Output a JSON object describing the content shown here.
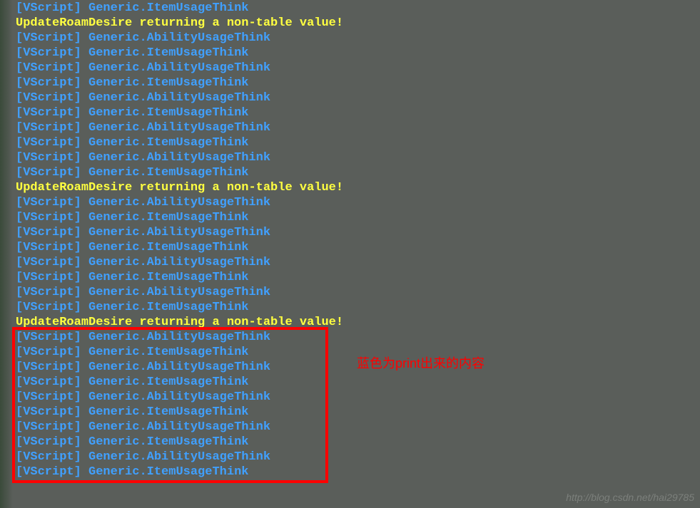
{
  "console": {
    "prefix": "[VScript]",
    "ability_msg": "Generic.AbilityUsageThink",
    "item_msg": "Generic.ItemUsageThink",
    "warning_msg": "UpdateRoamDesire returning a non-table value!",
    "lines": [
      {
        "type": "item"
      },
      {
        "type": "warning"
      },
      {
        "type": "ability"
      },
      {
        "type": "item"
      },
      {
        "type": "ability"
      },
      {
        "type": "item"
      },
      {
        "type": "ability"
      },
      {
        "type": "item"
      },
      {
        "type": "ability"
      },
      {
        "type": "item"
      },
      {
        "type": "ability"
      },
      {
        "type": "item"
      },
      {
        "type": "warning"
      },
      {
        "type": "ability"
      },
      {
        "type": "item"
      },
      {
        "type": "ability"
      },
      {
        "type": "item"
      },
      {
        "type": "ability"
      },
      {
        "type": "item"
      },
      {
        "type": "ability"
      },
      {
        "type": "item"
      },
      {
        "type": "warning"
      },
      {
        "type": "ability"
      },
      {
        "type": "item"
      },
      {
        "type": "ability"
      },
      {
        "type": "item"
      },
      {
        "type": "ability"
      },
      {
        "type": "item"
      },
      {
        "type": "ability"
      },
      {
        "type": "item"
      },
      {
        "type": "ability"
      },
      {
        "type": "item"
      }
    ]
  },
  "annotation_text": "蓝色为print出来的内容",
  "watermark_text": "http://blog.csdn.net/hai29785"
}
